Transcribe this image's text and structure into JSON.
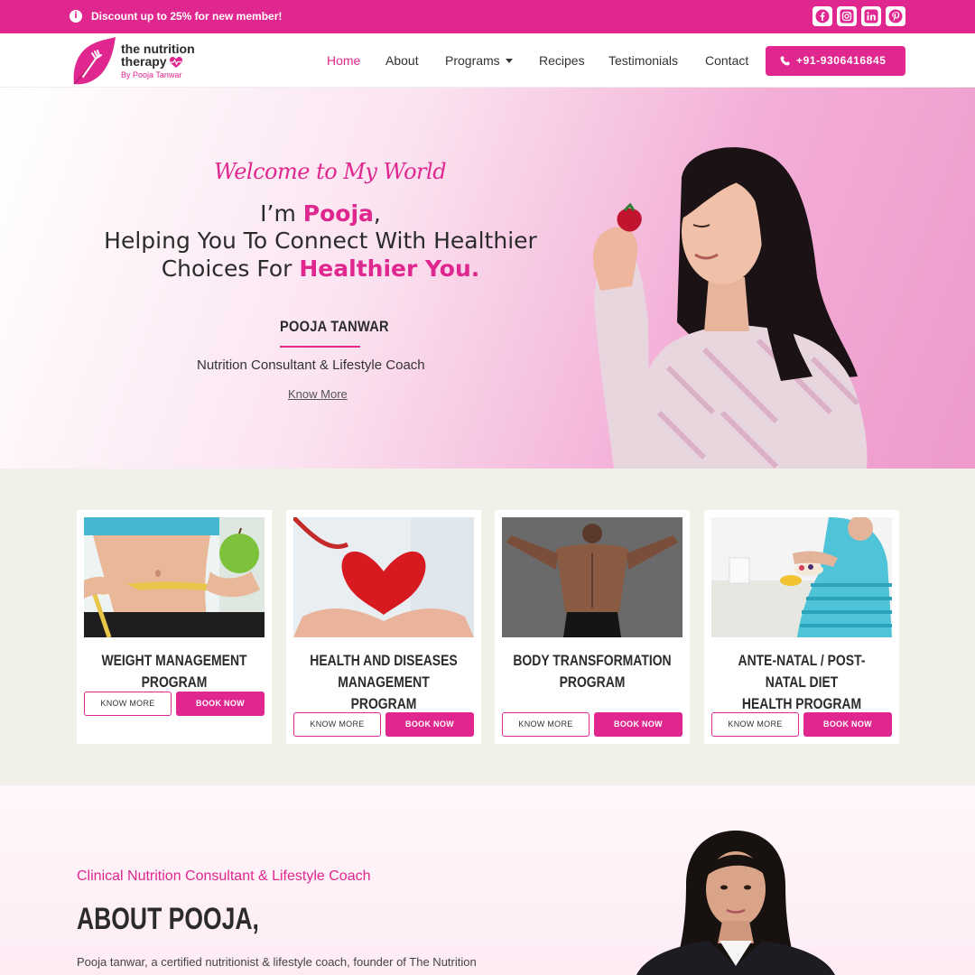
{
  "topbar": {
    "info_icon": "info-icon",
    "promo": "Discount up to 25% for new member!",
    "social": [
      "facebook-icon",
      "instagram-icon",
      "linkedin-icon",
      "pinterest-icon"
    ]
  },
  "brand": {
    "line1": "the nutrition",
    "line2": "therapy",
    "byline": "By Pooja Tanwar"
  },
  "nav": {
    "items": [
      {
        "label": "Home",
        "active": true
      },
      {
        "label": "About"
      },
      {
        "label": "Programs",
        "dropdown": true
      },
      {
        "label": "Recipes"
      },
      {
        "label": "Testimonials"
      },
      {
        "label": "Contact"
      }
    ],
    "phone": "+91-9306416845"
  },
  "hero": {
    "welcome": "Welcome to My World",
    "line1_pre": "I’m ",
    "line1_name": "Pooja",
    "line1_post": ",",
    "line2": "Helping You To Connect With Healthier",
    "line3_pre": "Choices For ",
    "line3_em": "Healthier You.",
    "name": "POOJA TANWAR",
    "role": "Nutrition Consultant & Lifestyle Coach",
    "more": "Know More"
  },
  "programs": [
    {
      "title_lines": [
        "WEIGHT MANAGEMENT PROGRAM"
      ],
      "know": "KNOW MORE",
      "book": "BOOK NOW"
    },
    {
      "title_lines": [
        "HEALTH AND DISEASES",
        "MANAGEMENT PROGRAM"
      ],
      "know": "KNOW MORE",
      "book": "BOOK NOW"
    },
    {
      "title_lines": [
        "BODY TRANSFORMATION",
        "PROGRAM"
      ],
      "know": "KNOW MORE",
      "book": "BOOK NOW"
    },
    {
      "title_lines": [
        "ANTE-NATAL / POST-NATAL DIET",
        "HEALTH PROGRAM"
      ],
      "know": "KNOW MORE",
      "book": "BOOK NOW"
    }
  ],
  "about": {
    "subtitle": "Clinical Nutrition Consultant & Lifestyle Coach",
    "title": "ABOUT POOJA,",
    "text": "Pooja tanwar, a certified nutritionist & lifestyle coach, founder of The Nutrition"
  },
  "colors": {
    "accent": "#e0268f",
    "section_bg": "#f1f1ea"
  }
}
